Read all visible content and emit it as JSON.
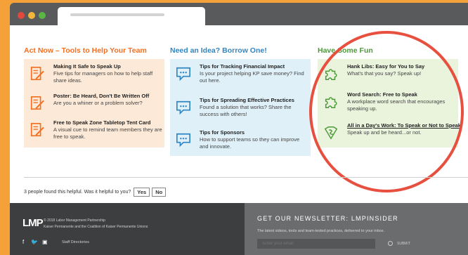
{
  "sections": [
    {
      "heading": "Act Now – Tools to Help Your Team",
      "color": "#f36f21",
      "items": [
        {
          "title": "Making It Safe to Speak Up",
          "desc": "Five tips for managers on how to help staff share ideas.",
          "icon": "document-pencil-icon"
        },
        {
          "title": "Poster: Be Heard, Don't Be Written Off",
          "desc": "Are you a whiner or a problem solver?",
          "icon": "document-pencil-icon"
        },
        {
          "title": "Free to Speak Zone Tabletop Tent Card",
          "desc": "A visual cue to remind team members they are free to speak.",
          "icon": "document-pencil-icon"
        }
      ]
    },
    {
      "heading": "Need an Idea? Borrow One!",
      "color": "#2f86c3",
      "items": [
        {
          "title": "Tips for Tracking Financial Impact",
          "desc": "Is your project helping KP save money? Find out here.",
          "icon": "speech-bubble-icon"
        },
        {
          "title": "Tips for Spreading Effective Practices",
          "desc": "Found a solution that works? Share the success with others!",
          "icon": "speech-bubble-icon"
        },
        {
          "title": "Tips for Sponsors",
          "desc": "How to support teams so they can improve and innovate.",
          "icon": "speech-bubble-icon"
        }
      ]
    },
    {
      "heading": "Have Some Fun",
      "color": "#4d9a3a",
      "items": [
        {
          "title": "Hank Libs: Easy for You to Say",
          "desc": "What's that you say? Speak up!",
          "icon": "puzzle-icon"
        },
        {
          "title": "Word Search: Free to Speak",
          "desc": "A workplace word search that encourages speaking up.",
          "icon": "puzzle-icon"
        },
        {
          "title": "All in a Day's Work: To Speak or Not to Speak",
          "desc": "Speak up and be heard...or not.",
          "icon": "superhero-icon"
        }
      ]
    }
  ],
  "feedback": {
    "question": "3 people found this helpful. Was it helpful to you?",
    "yes": "Yes",
    "no": "No"
  },
  "footer": {
    "logo": "LMP",
    "copyright": "© 2018 Labor Management Partnership",
    "org": "Kaiser Permanente and the Coalition of Kaiser Permanente Unions",
    "staff_link": "Staff Directories",
    "social": [
      "f",
      "🐦",
      "▣"
    ]
  },
  "newsletter": {
    "title": "GET OUR NEWSLETTER: LMPINSIDER",
    "desc": "The latest videos, tools and team-tested practices, delivered to your inbox.",
    "placeholder": "Enter your email",
    "submit": "SUBMIT"
  }
}
